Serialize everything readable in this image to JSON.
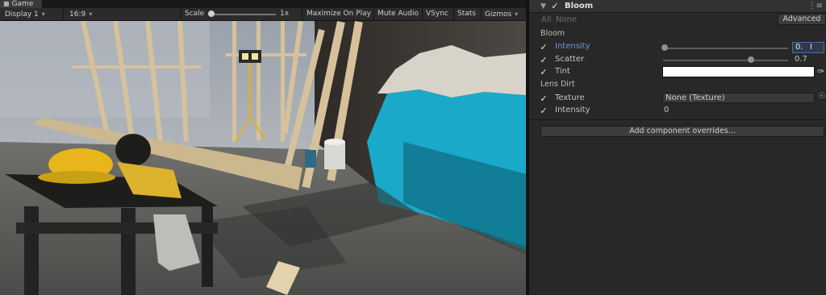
{
  "game": {
    "tab_title": "Game",
    "display": "Display 1",
    "aspect": "16:9",
    "scale_label": "Scale",
    "scale_value": "1x",
    "maximize": "Maximize On Play",
    "mute": "Mute Audio",
    "vsync": "VSync",
    "stats": "Stats",
    "gizmos": "Gizmos"
  },
  "inspector": {
    "component_title": "Bloom",
    "all_label": "All",
    "none_label": "None",
    "advanced_button": "Advanced",
    "section_bloom": "Bloom",
    "intensity_label": "Intensity",
    "intensity_value": "0.",
    "scatter_label": "Scatter",
    "scatter_value": "0.7",
    "tint_label": "Tint",
    "section_lens_dirt": "Lens Dirt",
    "texture_label": "Texture",
    "texture_value": "None (Texture)",
    "dirt_intensity_label": "Intensity",
    "dirt_intensity_value": "0",
    "add_overrides_button": "Add component overrides...",
    "tint_color": "#ffffff",
    "scatter_slider_fraction": 0.7
  },
  "colors": {
    "active_label": "#6a9bd6",
    "focus_border": "#4a6ea5",
    "wall_teal": "#1aa9c8"
  },
  "icons": {
    "game_tab": "game-controller-icon",
    "fold": "fold-arrow-icon",
    "checkbox": "checkmark-icon",
    "component_menu": "component-menu-icon",
    "eyedropper": "eyedropper-icon",
    "texture_picker": "object-picker-icon",
    "text_cursor": "text-cursor-icon"
  }
}
